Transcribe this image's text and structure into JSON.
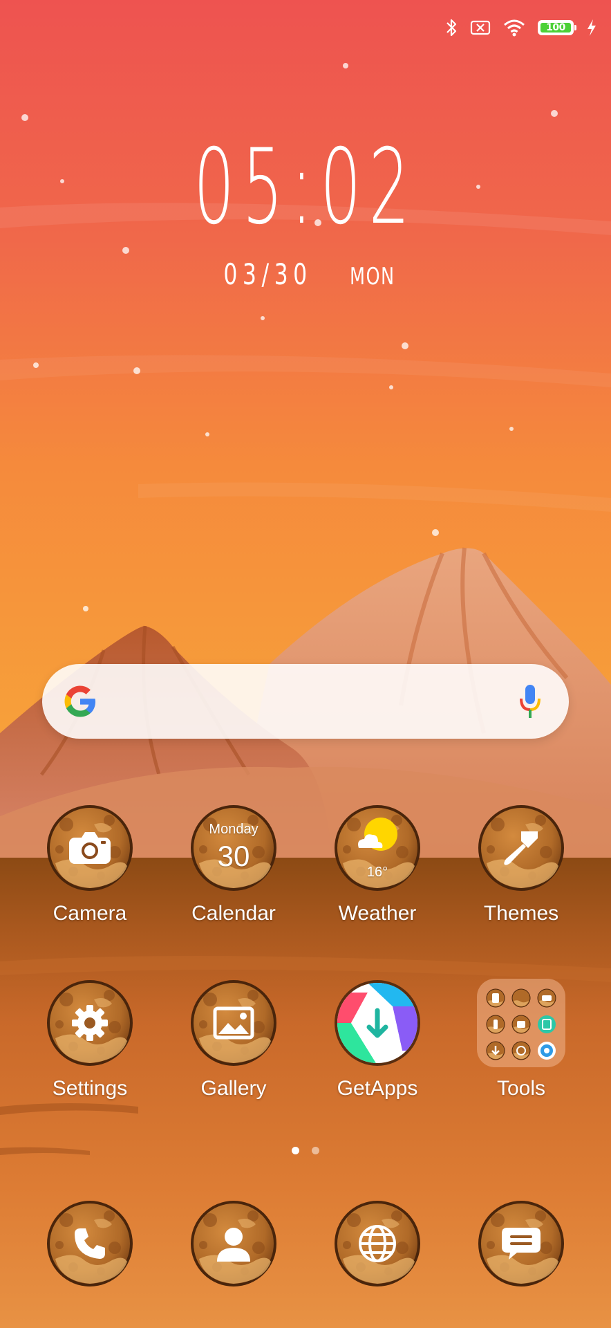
{
  "status_bar": {
    "icons": [
      "bluetooth-icon",
      "no-sim-icon",
      "wifi-icon",
      "battery-icon",
      "charging-icon"
    ],
    "battery_level": "100",
    "battery_fraction": 1.0
  },
  "lock_clock": {
    "time": "05:02",
    "date": "03/30",
    "day": "MON"
  },
  "search_widget": {
    "logo": "google-g-icon",
    "mic": "mic-icon"
  },
  "apps": {
    "row1": [
      {
        "label": "Camera",
        "icon": "camera-icon"
      },
      {
        "label": "Calendar",
        "icon": "calendar-icon",
        "day_name": "Monday",
        "day_number": "30"
      },
      {
        "label": "Weather",
        "icon": "weather-icon",
        "temperature": "16°"
      },
      {
        "label": "Themes",
        "icon": "paintbrush-icon"
      }
    ],
    "row2": [
      {
        "label": "Settings",
        "icon": "gear-icon"
      },
      {
        "label": "Gallery",
        "icon": "image-icon"
      },
      {
        "label": "GetApps",
        "icon": "getapps-icon"
      },
      {
        "label": "Tools",
        "icon": "folder-icon"
      }
    ]
  },
  "pager": {
    "pages": 2,
    "current": 1
  },
  "dock": [
    {
      "icon": "phone-icon"
    },
    {
      "icon": "contacts-icon"
    },
    {
      "icon": "browser-globe-icon"
    },
    {
      "icon": "messages-icon"
    }
  ],
  "colors": {
    "sky_top": "#EF5350",
    "sky_mid": "#F5842E",
    "sand": "#D9742A",
    "planet": "#B9702A",
    "accent_green": "#4CD137"
  }
}
